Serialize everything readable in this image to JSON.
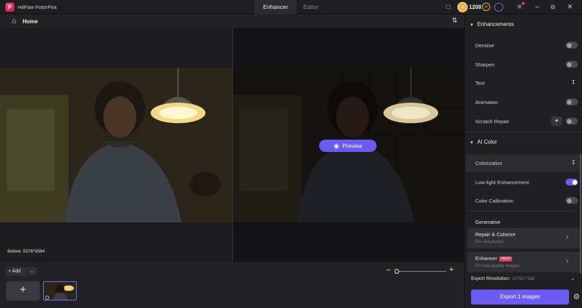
{
  "app": {
    "title": "HitPaw FotorPea",
    "logo_letter": "P"
  },
  "tabs": [
    {
      "label": "Enhancer",
      "active": true
    },
    {
      "label": "Editor",
      "active": false
    }
  ],
  "coins": {
    "count": "1208"
  },
  "toolbar": {
    "home_label": "Home"
  },
  "canvas": {
    "preview_label": "Preview",
    "before_label": "Before: 5376*3584"
  },
  "bottom": {
    "add_label": "Add",
    "zoom_level": 0
  },
  "panel": {
    "enhancements_title": "Enhancements",
    "enhancements": [
      {
        "label": "Denoise",
        "control": "toggle",
        "on": false
      },
      {
        "label": "Sharpen",
        "control": "toggle",
        "on": false
      },
      {
        "label": "Text",
        "control": "download"
      },
      {
        "label": "Animation",
        "control": "toggle",
        "on": false
      },
      {
        "label": "Scratch Repair",
        "control": "toggle",
        "on": false
      }
    ],
    "ai_color_title": "AI Color",
    "ai_color": [
      {
        "label": "Colorization",
        "control": "download"
      },
      {
        "label": "Low-light Enhancement",
        "control": "toggle",
        "on": true
      },
      {
        "label": "Color Calibration",
        "control": "toggle",
        "on": false
      }
    ],
    "generative_title": "Generative",
    "generative": [
      {
        "title": "Repair & Colorize",
        "subtitle": "For old photos",
        "badge": ""
      },
      {
        "title": "Enhancer",
        "subtitle": "For low-quality images",
        "badge": "NEW"
      }
    ],
    "export_resolution_label": "Export Resolution:",
    "export_resolution_value": "10752*7168",
    "export_button": "Export 1 images"
  },
  "colors": {
    "accent": "#6a5cf2",
    "badge_new": "#e0405e",
    "coin": "#f1b23a"
  },
  "icons": [
    "app-logo-icon",
    "chat-icon",
    "coin-icon",
    "plus-icon",
    "user-icon",
    "menu-icon",
    "minimize-icon",
    "restore-icon",
    "close-icon",
    "home-icon",
    "compare-icon",
    "eye-icon",
    "gear-icon",
    "chevron-right-icon",
    "download-icon",
    "wand-icon"
  ]
}
